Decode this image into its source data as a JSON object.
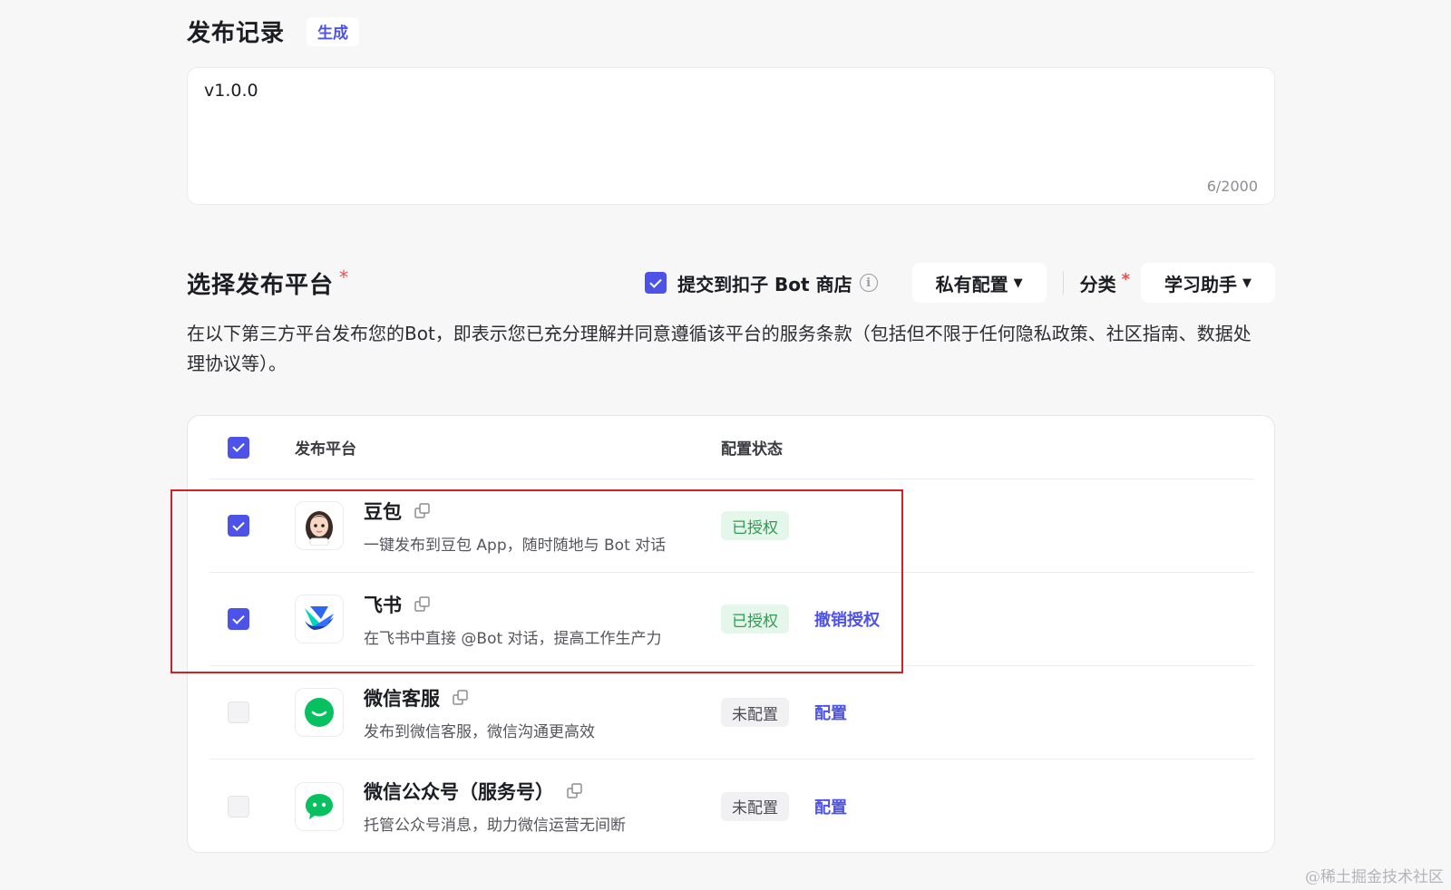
{
  "release": {
    "title": "发布记录",
    "generate_label": "生成",
    "notes_value": "v1.0.0",
    "counter": "6/2000"
  },
  "platforms": {
    "title": "选择发布平台",
    "required_mark": "*",
    "store_checkbox_label": "提交到扣子 Bot 商店",
    "store_checked": true,
    "privacy_dropdown": "私有配置",
    "category_label": "分类",
    "category_required": "*",
    "category_value": "学习助手",
    "description": "在以下第三方平台发布您的Bot，即表示您已充分理解并同意遵循该平台的服务条款（包括但不限于任何隐私政策、社区指南、数据处理协议等）。"
  },
  "table": {
    "headers": {
      "platform": "发布平台",
      "status": "配置状态"
    },
    "rows": [
      {
        "name": "豆包",
        "desc": "一键发布到豆包 App，随时随地与 Bot 对话",
        "status": "已授权",
        "action": "",
        "checked": true,
        "icon": "doubao-avatar-icon"
      },
      {
        "name": "飞书",
        "desc": "在飞书中直接 @Bot 对话，提高工作生产力",
        "status": "已授权",
        "action": "撤销授权",
        "checked": true,
        "icon": "feishu-logo-icon"
      },
      {
        "name": "微信客服",
        "desc": "发布到微信客服，微信沟通更高效",
        "status": "未配置",
        "action": "配置",
        "checked": false,
        "icon": "wechat-service-icon"
      },
      {
        "name": "微信公众号（服务号）",
        "desc": "托管公众号消息，助力微信运营无间断",
        "status": "未配置",
        "action": "配置",
        "checked": false,
        "icon": "wechat-official-icon"
      }
    ]
  },
  "colors": {
    "accent": "#4d53e8",
    "authorized": "#2f9a52",
    "highlight": "#d0202a"
  },
  "watermark": "@稀土掘金技术社区"
}
